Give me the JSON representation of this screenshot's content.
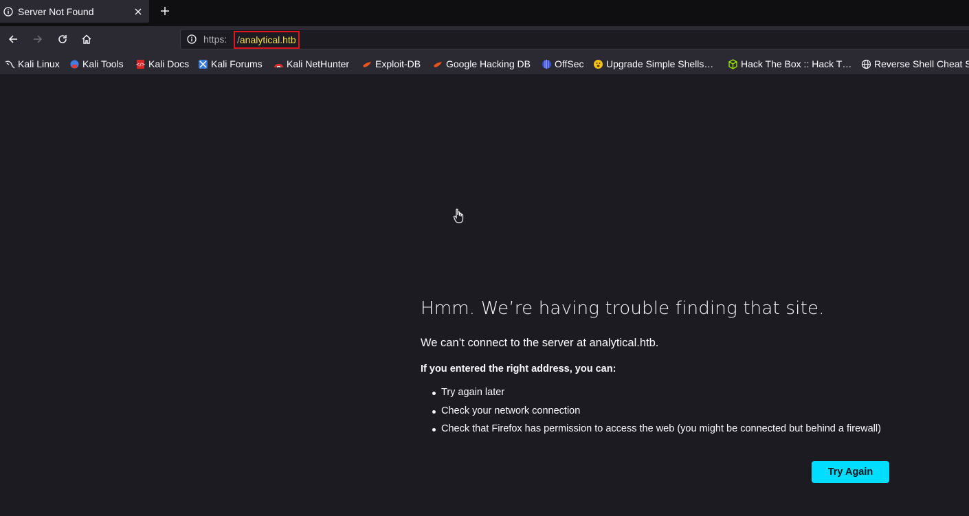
{
  "tab": {
    "title": "Server Not Found",
    "icon": "info-icon"
  },
  "toolbar": {
    "back_icon": "back-arrow-icon",
    "forward_icon": "forward-arrow-icon",
    "reload_icon": "reload-icon",
    "home_icon": "home-icon"
  },
  "urlbar": {
    "scheme": "https:",
    "slash": "/",
    "host": "analytical.htb",
    "highlight_color": "#e0161e"
  },
  "bookmarks": [
    {
      "label": "Kali Linux",
      "icon": "kali-dragon-icon"
    },
    {
      "label": "Kali Tools",
      "icon": "kali-tools-icon"
    },
    {
      "label": "Kali Docs",
      "icon": "kali-docs-icon"
    },
    {
      "label": "Kali Forums",
      "icon": "kali-forums-icon"
    },
    {
      "label": "Kali NetHunter",
      "icon": "kali-nethunter-icon"
    },
    {
      "label": "Exploit-DB",
      "icon": "exploit-db-icon"
    },
    {
      "label": "Google Hacking DB",
      "icon": "google-hacking-db-icon"
    },
    {
      "label": "OffSec",
      "icon": "offsec-icon"
    },
    {
      "label": "Upgrade Simple Shells…",
      "icon": "upgrade-shells-icon"
    },
    {
      "label": "Hack The Box :: Hack T…",
      "icon": "hack-the-box-icon"
    },
    {
      "label": "Reverse Shell Cheat S",
      "icon": "globe-icon"
    }
  ],
  "error": {
    "title": "Hmm. We’re having trouble finding that site.",
    "description": "We can’t connect to the server at analytical.htb.",
    "subhead": "If you entered the right address, you can:",
    "suggestions": [
      "Try again later",
      "Check your network connection",
      "Check that Firefox has permission to access the web (you might be connected but behind a firewall)"
    ],
    "button_label": "Try Again",
    "button_color": "#00ddff"
  }
}
